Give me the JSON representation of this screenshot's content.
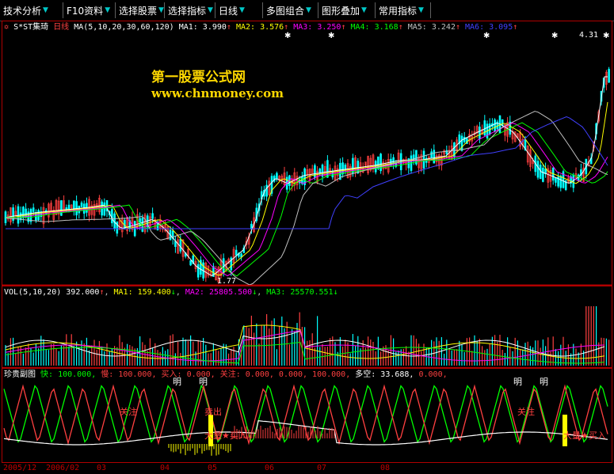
{
  "toolbar": {
    "items": [
      {
        "label": "技术分析"
      },
      {
        "label": "F10资料"
      },
      {
        "label": "选择股票"
      },
      {
        "label": "选择指标"
      },
      {
        "label": "日线"
      },
      {
        "label": "多图组合"
      },
      {
        "label": "图形叠加"
      },
      {
        "label": "常用指标"
      }
    ]
  },
  "main_panel": {
    "stock_name": "S*ST集琦",
    "period": "日线",
    "indicator": "MA(5,10,20,30,60,120)",
    "ma": [
      {
        "label": "MA1:",
        "value": "3.990",
        "color": "#ffffff"
      },
      {
        "label": "MA2:",
        "value": "3.576",
        "color": "#ffff00"
      },
      {
        "label": "MA3:",
        "value": "3.250",
        "color": "#ff00ff"
      },
      {
        "label": "MA4:",
        "value": "3.168",
        "color": "#00ff00"
      },
      {
        "label": "MA5:",
        "value": "3.242",
        "color": "#c0c0c0"
      },
      {
        "label": "MA6:",
        "value": "3.095",
        "color": "#4040ff"
      }
    ],
    "high_label": "4.31",
    "low_label": "1.77",
    "watermark_title": "第一股票公式网",
    "watermark_url": "www.chnmoney.com"
  },
  "vol_panel": {
    "indicator": "VOL(5,10,20)",
    "value": "392.000",
    "ma1": "159.400",
    "ma2": "25805.500",
    "ma3": "25570.551"
  },
  "ind_panel": {
    "name": "珍贵副图",
    "fast": "快: 100.000,",
    "slow": "慢: 100.000,",
    "buy": "买入: 0.000,",
    "watch": "关注: 0.000, 0.000, 100.000,",
    "longshort": "多空: 33.688,",
    "tail": "0.000,",
    "labels": {
      "ming": "明",
      "guanzhu": "关注",
      "maichu": "卖出",
      "buy_signal": "大量★买入"
    }
  },
  "dates": [
    "2005/12",
    "2006/02",
    "03",
    "04",
    "05",
    "06",
    "07",
    "08"
  ],
  "colors": {
    "up": "#ff4040",
    "down": "#00ffff",
    "grid": "#b00000"
  }
}
